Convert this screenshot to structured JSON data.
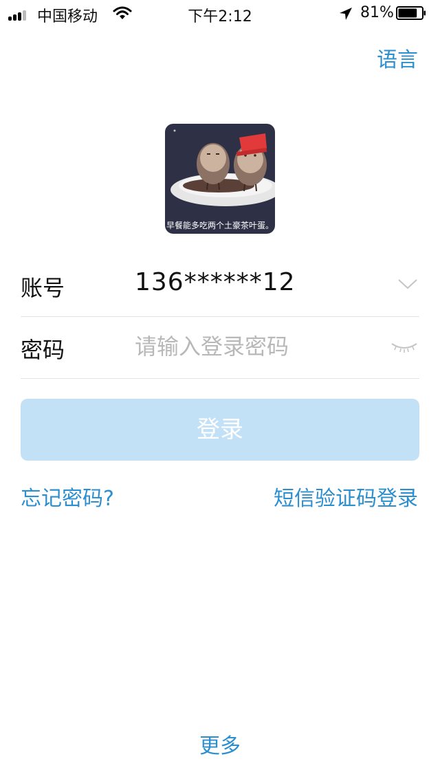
{
  "status_bar": {
    "carrier": "中国移动",
    "time": "下午2:12",
    "battery_percent": "81%",
    "battery_level": 0.81,
    "icons": [
      "signal-icon",
      "wifi-icon",
      "location-arrow-icon",
      "battery-icon"
    ]
  },
  "header": {
    "language_label": "语言"
  },
  "avatar": {
    "caption": "早餐能多吃两个土豪茶叶蛋。"
  },
  "form": {
    "account_label": "账号",
    "account_value": "136******12",
    "password_label": "密码",
    "password_placeholder": "请输入登录密码"
  },
  "actions": {
    "login_label": "登录",
    "forgot_label": "忘记密码?",
    "sms_login_label": "短信验证码登录",
    "more_label": "更多"
  },
  "colors": {
    "link": "#2b8fcf",
    "button_disabled": "#c3e1f6",
    "divider": "#e3e3e3"
  }
}
